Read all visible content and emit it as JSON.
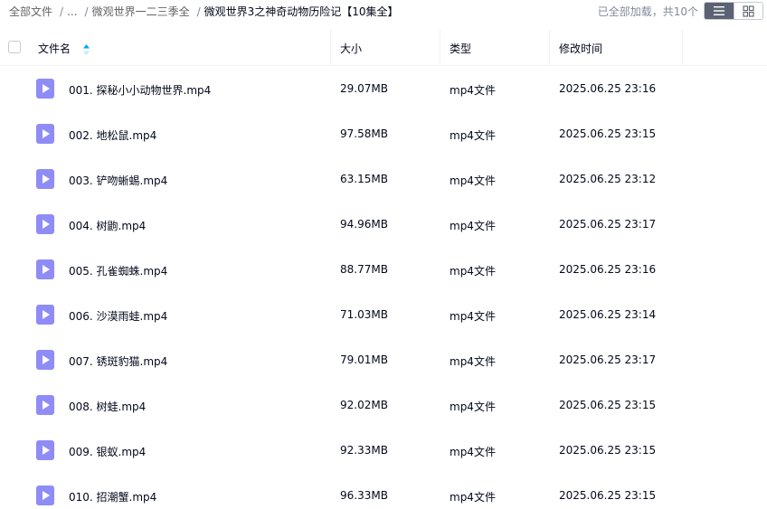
{
  "breadcrumb": {
    "root": "全部文件",
    "ellipsis": "...",
    "parent": "微观世界一二三季全",
    "current": "微观世界3之神奇动物历险记【10集全】",
    "separator": "/"
  },
  "status": {
    "loaded_text": "已全部加载，共10个"
  },
  "view_modes": {
    "active": "list",
    "list_icon": "list-icon",
    "grid_icon": "grid-icon"
  },
  "columns": {
    "name": "文件名",
    "size": "大小",
    "type": "类型",
    "modified": "修改时间"
  },
  "colors": {
    "file_icon": "#8f8cf7",
    "sort_arrow": "#06a7ff"
  },
  "files": [
    {
      "name": "001. 探秘小小动物世界.mp4",
      "size": "29.07MB",
      "type": "mp4文件",
      "modified": "2025.06.25 23:16"
    },
    {
      "name": "002. 地松鼠.mp4",
      "size": "97.58MB",
      "type": "mp4文件",
      "modified": "2025.06.25 23:15"
    },
    {
      "name": "003. 铲吻蜥蜴.mp4",
      "size": "63.15MB",
      "type": "mp4文件",
      "modified": "2025.06.25 23:12"
    },
    {
      "name": "004. 树鼩.mp4",
      "size": "94.96MB",
      "type": "mp4文件",
      "modified": "2025.06.25 23:17"
    },
    {
      "name": "005. 孔雀蜘蛛.mp4",
      "size": "88.77MB",
      "type": "mp4文件",
      "modified": "2025.06.25 23:16"
    },
    {
      "name": "006. 沙漠雨蛙.mp4",
      "size": "71.03MB",
      "type": "mp4文件",
      "modified": "2025.06.25 23:14"
    },
    {
      "name": "007. 锈斑豹猫.mp4",
      "size": "79.01MB",
      "type": "mp4文件",
      "modified": "2025.06.25 23:17"
    },
    {
      "name": "008. 树蛙.mp4",
      "size": "92.02MB",
      "type": "mp4文件",
      "modified": "2025.06.25 23:15"
    },
    {
      "name": "009. 银蚁.mp4",
      "size": "92.33MB",
      "type": "mp4文件",
      "modified": "2025.06.25 23:15"
    },
    {
      "name": "010. 招潮蟹.mp4",
      "size": "96.33MB",
      "type": "mp4文件",
      "modified": "2025.06.25 23:15"
    }
  ]
}
